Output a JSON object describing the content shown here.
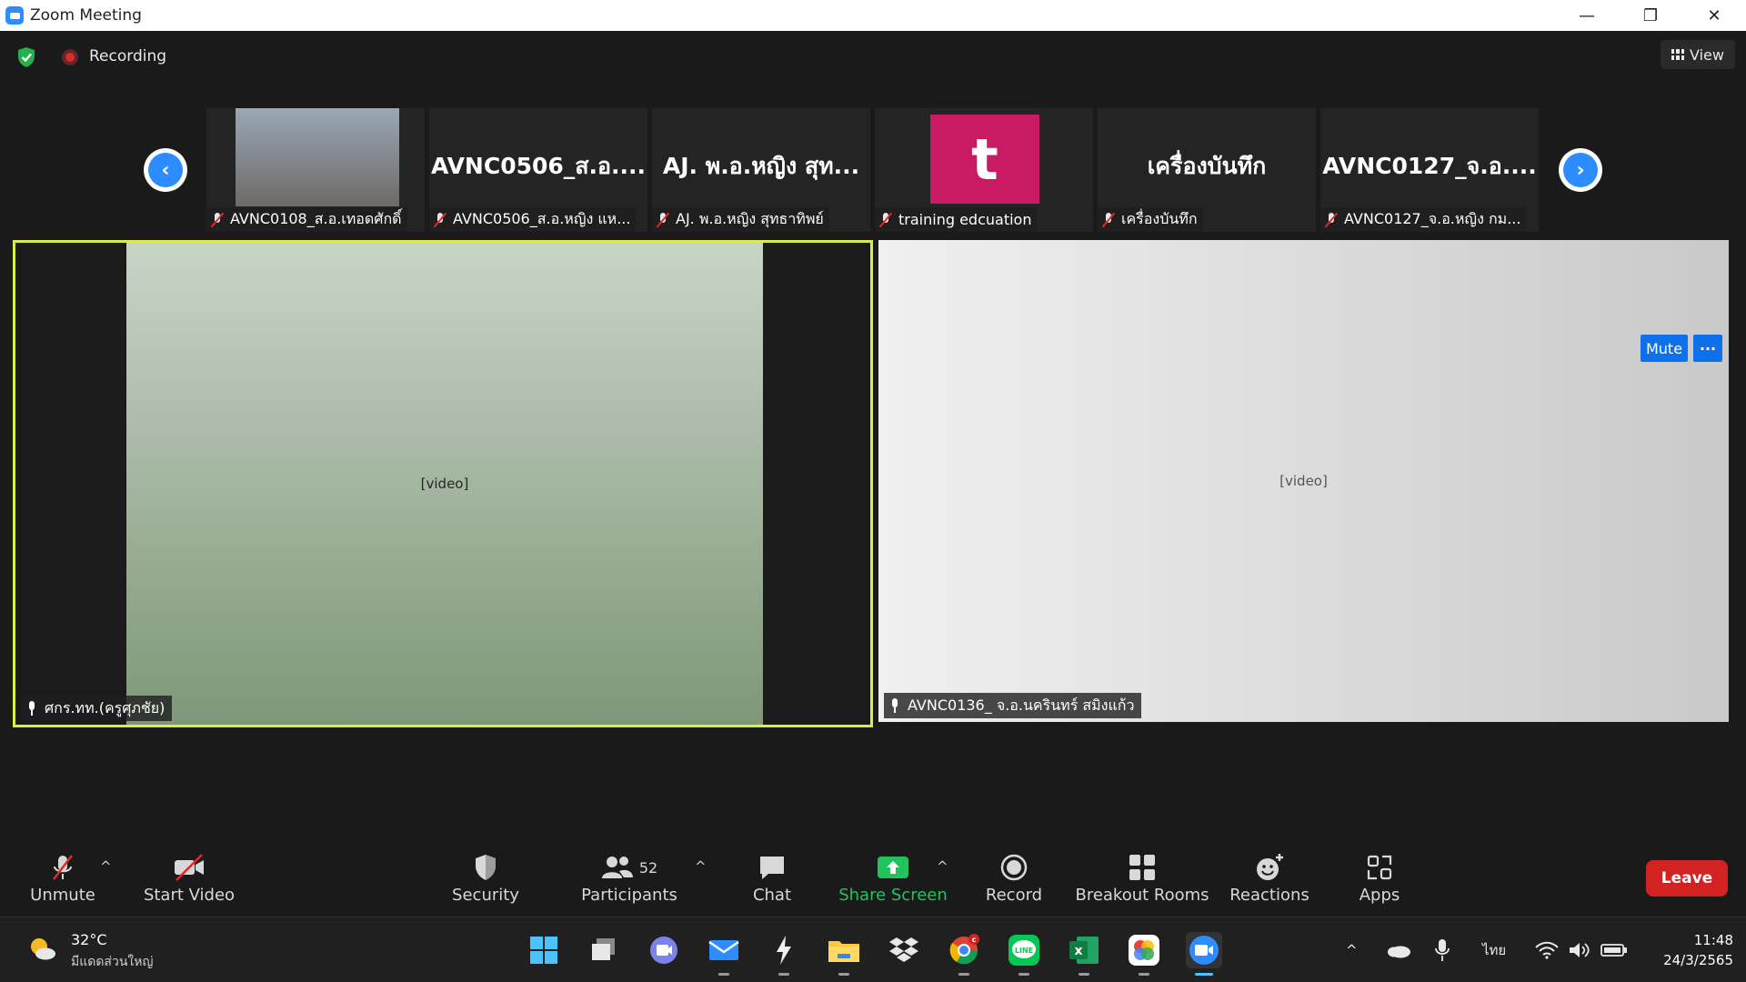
{
  "window": {
    "title": "Zoom Meeting",
    "minimize": "—",
    "restore": "❐",
    "close": "✕"
  },
  "status": {
    "recording_label": "Recording",
    "view_label": "View"
  },
  "gallery": {
    "prev": "‹",
    "next": "›",
    "thumbs": [
      {
        "title": "",
        "name": "AVNC0108_ส.อ.เทอดศักดิ์",
        "video_on": true
      },
      {
        "title": "AVNC0506_ส.อ....",
        "name": "AVNC0506_ส.อ.หญิง แห...",
        "video_on": false
      },
      {
        "title": "AJ. พ.อ.หญิง สุท...",
        "name": "AJ. พ.อ.หญิง สุทธาทิพย์",
        "video_on": false
      },
      {
        "avatar_letter": "t",
        "avatar_color": "#cb1a64",
        "name": "training edcuation",
        "video_on": false
      },
      {
        "title": "เครื่องบันทึก",
        "name": "เครื่องบันทึก",
        "video_on": false
      },
      {
        "title": "AVNC0127_จ.อ....",
        "name": "AVNC0127_จ.อ.หญิง กม...",
        "video_on": false
      }
    ]
  },
  "main": {
    "left_tile": {
      "name": "ศกร.ทท.(ครูศุภชัย)",
      "highlight_color": "#d9ee4e"
    },
    "right_tile": {
      "name": "AVNC0136_ จ.อ.นครินทร์ สมิงแก้ว",
      "mute_label": "Mute",
      "more_label": "···"
    }
  },
  "toolbar": {
    "unmute": "Unmute",
    "start_video": "Start Video",
    "security": "Security",
    "participants": "Participants",
    "participants_count": "52",
    "chat": "Chat",
    "share_screen": "Share Screen",
    "record": "Record",
    "breakout_rooms": "Breakout Rooms",
    "reactions": "Reactions",
    "apps": "Apps",
    "leave": "Leave",
    "caret": "^"
  },
  "taskbar": {
    "weather_temp": "32°C",
    "weather_condition": "มีแดดส่วนใหญ่",
    "language": "ไทย",
    "time": "11:48",
    "date": "24/3/2565",
    "tray_up": "^",
    "chrome_badge": "c",
    "excel_letter": "x",
    "line_label": "LINE"
  },
  "colors": {
    "accent": "#0e71eb",
    "leave": "#d32222",
    "share": "#22c35e",
    "recording": "#e02828"
  }
}
